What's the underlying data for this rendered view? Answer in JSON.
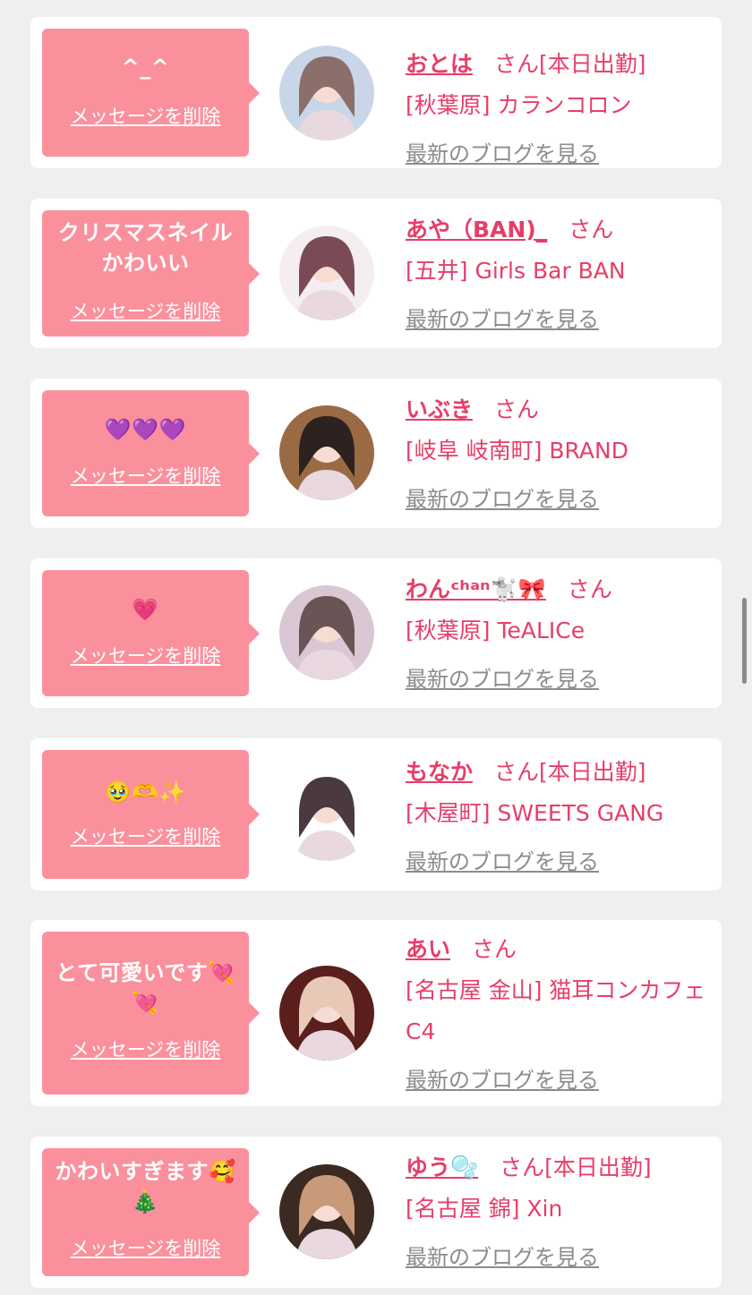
{
  "entries": [
    {
      "message": "^_^",
      "delete_label": "メッセージを削除",
      "name": "おとは",
      "honorific": "さん",
      "status": "[本日出勤]",
      "shop": "[秋葉原] カランコロン",
      "blog_label": "最新のブログを見る",
      "avatar_bg": "#c9d6e8",
      "avatar_fg": "#8a6f6a"
    },
    {
      "message": "クリスマスネイル\nかわいい",
      "delete_label": "メッセージを削除",
      "name": "あや（BAN)_",
      "honorific": "さん",
      "status": "",
      "shop": "[五井] Girls Bar BAN",
      "blog_label": "最新のブログを見る",
      "avatar_bg": "#f4eef0",
      "avatar_fg": "#7a4a55"
    },
    {
      "message": "💜💜💜",
      "delete_label": "メッセージを削除",
      "name": "いぶき",
      "honorific": "さん",
      "status": "",
      "shop": "[岐阜 岐南町] BRAND",
      "blog_label": "最新のブログを見る",
      "avatar_bg": "#9a6a45",
      "avatar_fg": "#2e2220"
    },
    {
      "message": "💗",
      "delete_label": "メッセージを削除",
      "name": "わんᶜʰᵃⁿ🐩🎀",
      "honorific": "さん",
      "status": "",
      "shop": "[秋葉原] TeALICe",
      "blog_label": "最新のブログを見る",
      "avatar_bg": "#d9c7d4",
      "avatar_fg": "#6b5455"
    },
    {
      "message": "🥹🫶✨",
      "delete_label": "メッセージを削除",
      "name": "もなか",
      "honorific": "さん",
      "status": "[本日出勤]",
      "shop": "[木屋町] SWEETS GANG",
      "blog_label": "最新のブログを見る",
      "avatar_bg": "#ffffff",
      "avatar_fg": "#4a3a40"
    },
    {
      "message": "とて可愛いです💘\n💘",
      "delete_label": "メッセージを削除",
      "name": "あい",
      "honorific": "さん",
      "status": "",
      "shop": "[名古屋 金山] 猫耳コンカフェ C4",
      "blog_label": "最新のブログを見る",
      "avatar_bg": "#5a1f1c",
      "avatar_fg": "#e8c9b8"
    },
    {
      "message": "かわいすぎます🥰\n🎄",
      "delete_label": "メッセージを削除",
      "name": "ゆう🫧",
      "honorific": "さん",
      "status": "[本日出勤]",
      "shop": "[名古屋 錦] Xin",
      "blog_label": "最新のブログを見る",
      "avatar_bg": "#3b2a22",
      "avatar_fg": "#c89a7a"
    }
  ],
  "colors": {
    "page_bg": "#efefef",
    "card_bg": "#ffffff",
    "bubble_bg": "#fb909d",
    "accent_text": "#e63e68",
    "blog_link": "#8c8c8c"
  }
}
